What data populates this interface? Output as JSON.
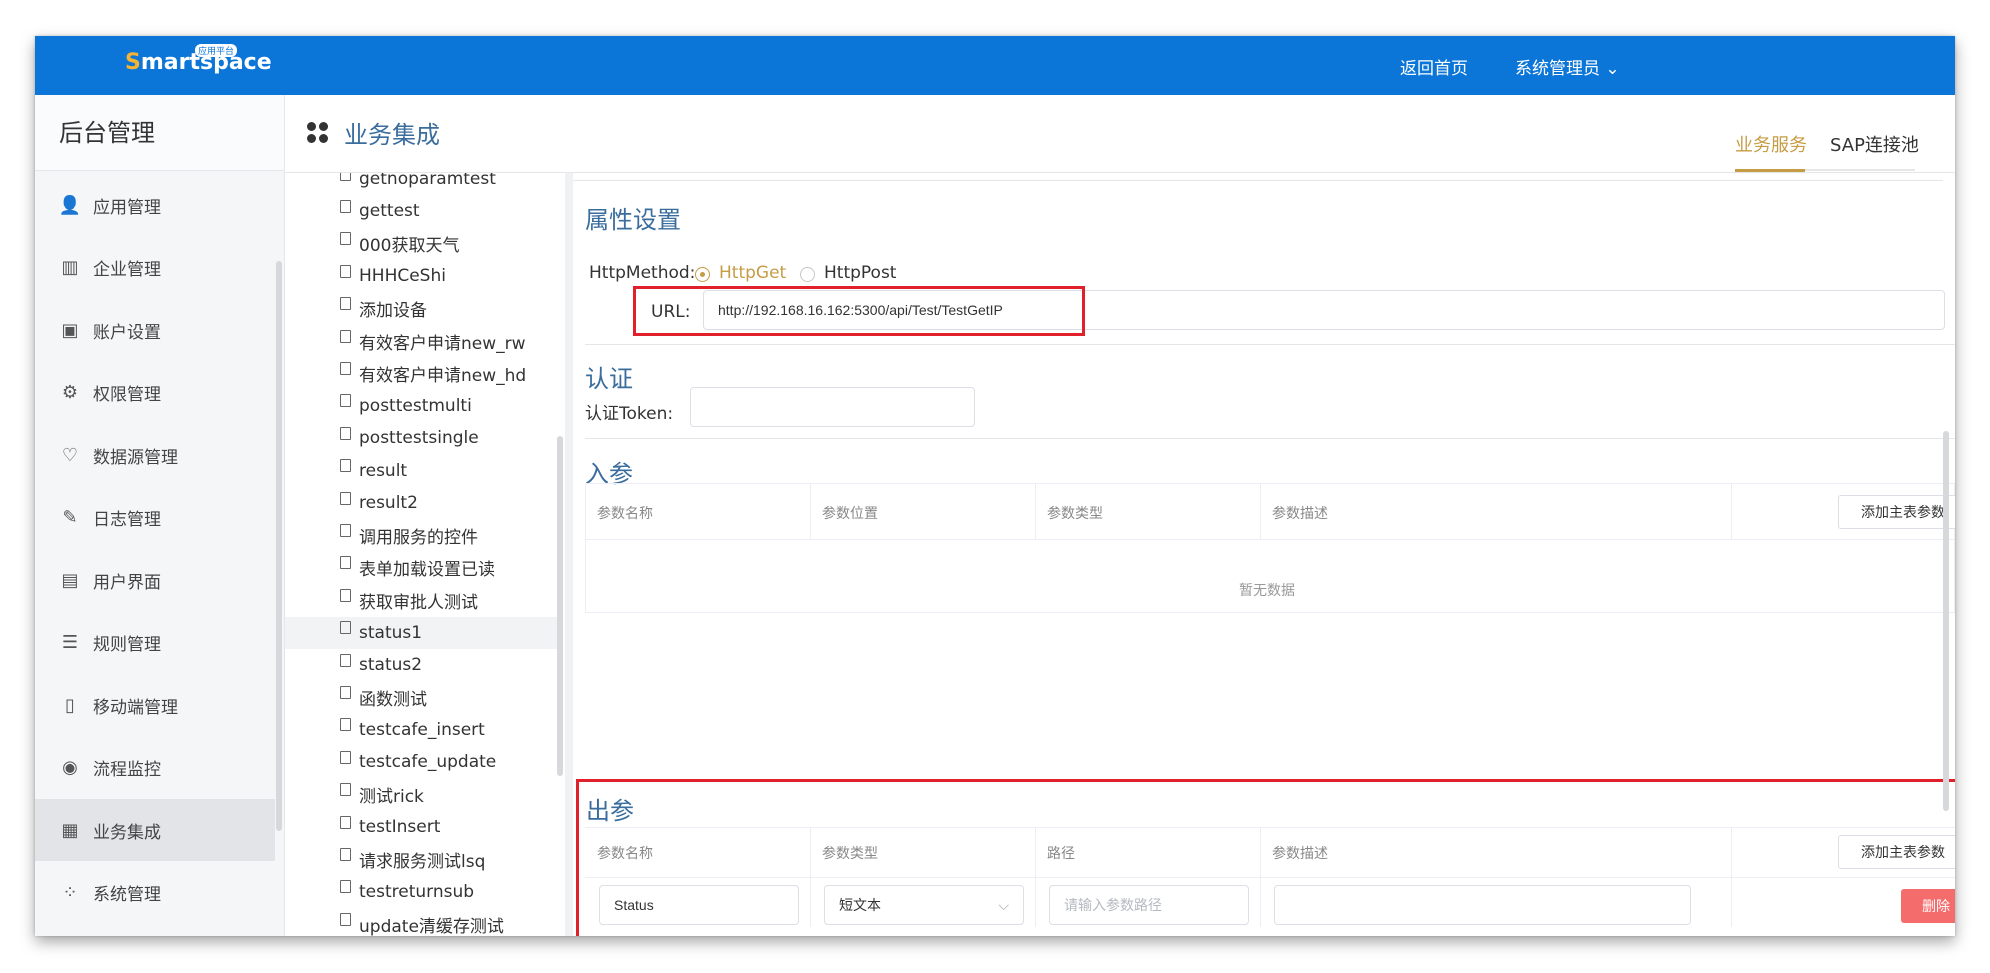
{
  "header": {
    "logo_main": "martspace",
    "logo_s": "S",
    "logo_badge": "应用平台",
    "home_link": "返回首页",
    "user_menu": "系统管理员 ⌄"
  },
  "sidebar": {
    "title": "后台管理",
    "items": [
      {
        "label": "应用管理",
        "icon": "app-manage-icon",
        "glyph": "👤"
      },
      {
        "label": "企业管理",
        "icon": "building-icon",
        "glyph": "▥"
      },
      {
        "label": "账户设置",
        "icon": "account-settings-icon",
        "glyph": "▣"
      },
      {
        "label": "权限管理",
        "icon": "permission-icon",
        "glyph": "⚙"
      },
      {
        "label": "数据源管理",
        "icon": "datasource-icon",
        "glyph": "♡"
      },
      {
        "label": "日志管理",
        "icon": "log-icon",
        "glyph": "✎"
      },
      {
        "label": "用户界面",
        "icon": "layout-icon",
        "glyph": "▤"
      },
      {
        "label": "规则管理",
        "icon": "rules-icon",
        "glyph": "☰"
      },
      {
        "label": "移动端管理",
        "icon": "mobile-icon",
        "glyph": "▯"
      },
      {
        "label": "流程监控",
        "icon": "monitor-icon",
        "glyph": "◉"
      },
      {
        "label": "业务集成",
        "icon": "integration-icon",
        "glyph": "▦"
      },
      {
        "label": "系统管理",
        "icon": "system-icon",
        "glyph": "⁘"
      }
    ],
    "active_index": 10
  },
  "main": {
    "title": "业务集成",
    "tabs": [
      {
        "label": "业务服务",
        "active": true
      },
      {
        "label": "SAP连接池",
        "active": false
      }
    ]
  },
  "tree": {
    "items": [
      "getnoparamtest",
      "gettest",
      "000获取天气",
      "HHHCeShi",
      "添加设备",
      "有效客户申请new_rw",
      "有效客户申请new_hd",
      "posttestmulti",
      "posttestsingle",
      "result",
      "result2",
      "调用服务的控件",
      "表单加载设置已读",
      "获取审批人测试",
      "status1",
      "status2",
      "函数测试",
      "testcafe_insert",
      "testcafe_update",
      "测试rick",
      "testInsert",
      "请求服务测试lsq",
      "testreturnsub",
      "update清缓存测试"
    ],
    "active_index": 14
  },
  "properties": {
    "title": "属性设置",
    "method_label": "HttpMethod:",
    "method_options": [
      "HttpGet",
      "HttpPost"
    ],
    "method_selected": "HttpGet",
    "url_label": "URL:",
    "url_value": "http://192.168.16.162:5300/api/Test/TestGetIP"
  },
  "auth": {
    "title": "认证",
    "token_label": "认证Token:",
    "token_value": ""
  },
  "input_params": {
    "title": "入参",
    "columns": [
      "参数名称",
      "参数位置",
      "参数类型",
      "参数描述"
    ],
    "add_button": "添加主表参数",
    "empty_text": "暂无数据"
  },
  "output_params": {
    "title": "出参",
    "columns": [
      "参数名称",
      "参数类型",
      "路径",
      "参数描述"
    ],
    "add_button": "添加主表参数",
    "rows": [
      {
        "name": "Status",
        "type": "短文本",
        "path_placeholder": "请输入参数路径",
        "description": "",
        "delete_label": "删除"
      }
    ]
  },
  "colors": {
    "topbar": "#0b76d8",
    "accent": "#c69c45",
    "section_title": "#3a6d9e",
    "highlight_box": "#e0202a",
    "danger": "#f56c6c"
  }
}
